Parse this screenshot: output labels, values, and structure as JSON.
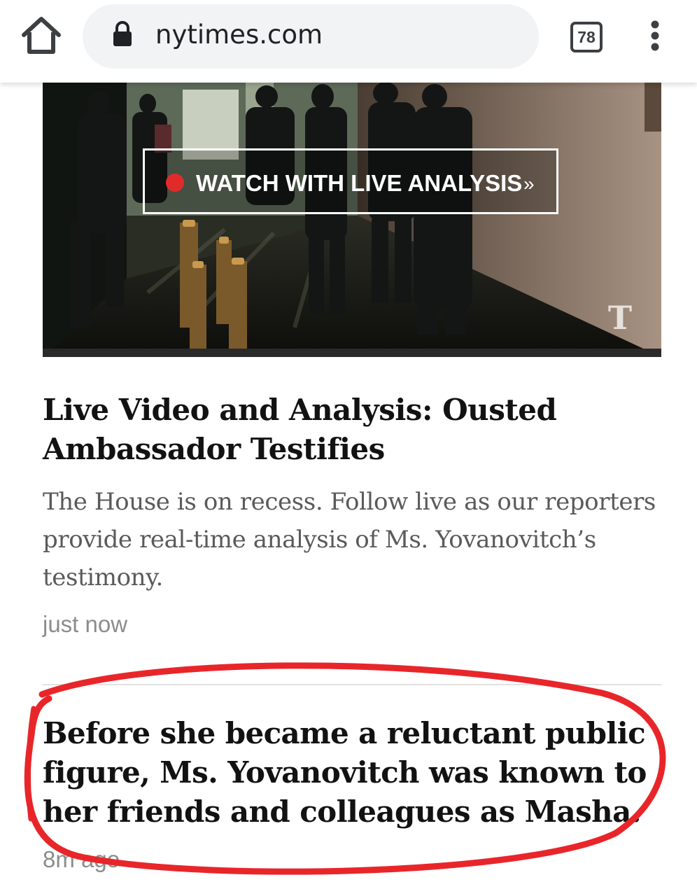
{
  "browser": {
    "url": "nytimes.com",
    "tab_count": "78",
    "icons": {
      "home": "home-icon",
      "lock": "lock-icon",
      "tabs": "tab-switcher-icon",
      "menu": "more-vertical-icon"
    }
  },
  "video": {
    "watch_label": "WATCH WITH LIVE ANALYSIS",
    "watch_arrow": "»",
    "live_dot_color": "#e02b2b",
    "logo_glyph": "T"
  },
  "articles": [
    {
      "headline": "Live Video and Analysis: Ousted Ambassador Testifies",
      "summary": "The House is on recess. Follow live as our reporters provide real-time analysis of Ms. Yovanovitch’s testimony.",
      "timestamp": "just now"
    },
    {
      "headline": "Before she became a reluctant public figure, Ms. Yovanovitch was known to her friends and colleagues as Masha.",
      "timestamp": "8m ago"
    }
  ],
  "colors": {
    "headline": "#121212",
    "summary": "#5a5a5a",
    "timestamp": "#8c8c8c",
    "annotation": "#e8262a"
  }
}
